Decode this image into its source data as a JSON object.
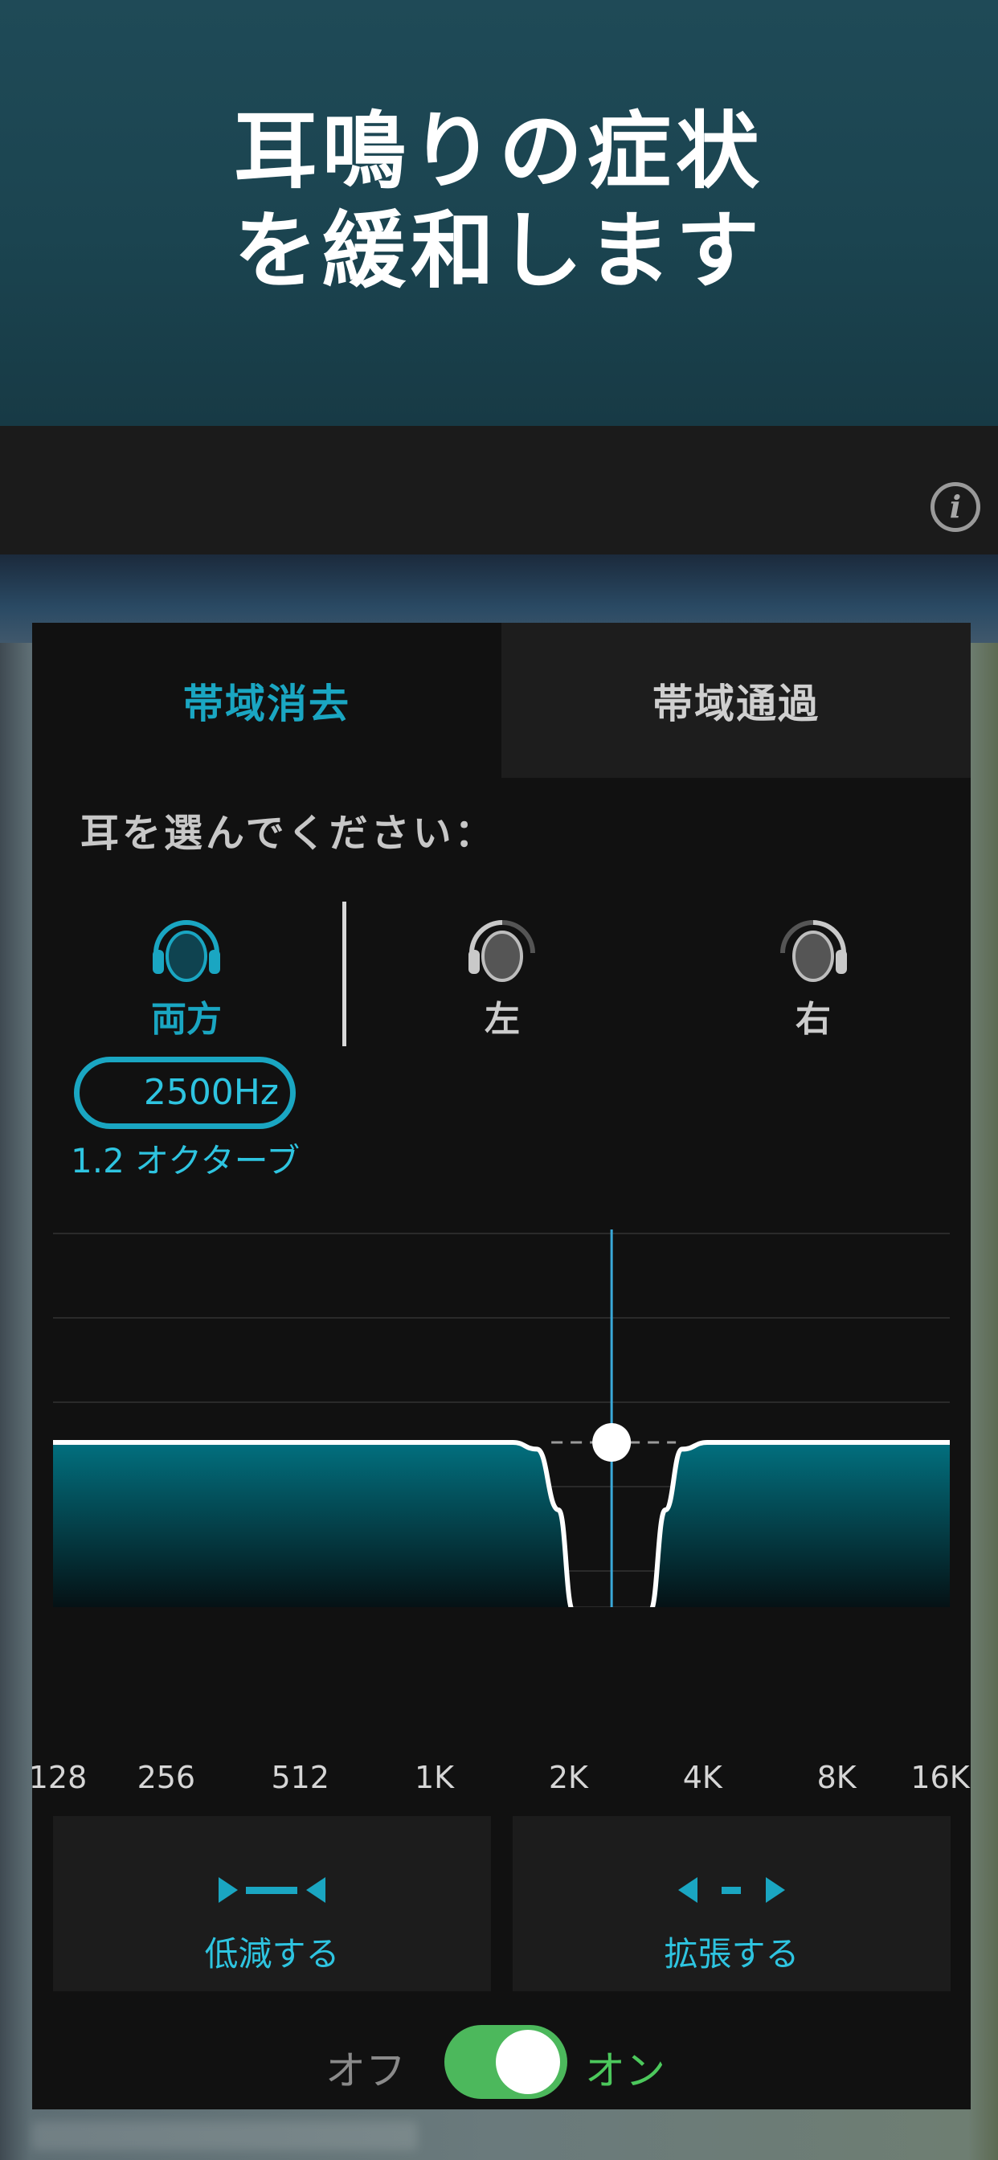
{
  "hero": {
    "line1": "耳鳴りの症状",
    "line2": "を緩和します"
  },
  "app_bar": {
    "info_glyph": "i",
    "info_icon": "info-icon"
  },
  "tabs": [
    {
      "label": "帯域消去",
      "active": true
    },
    {
      "label": "帯域通過",
      "active": false
    }
  ],
  "ear_select": {
    "prompt": "耳を選んでください：",
    "options": [
      {
        "label": "両方",
        "icon": "headphones-icon",
        "selected": true
      },
      {
        "label": "左",
        "icon": "head-left-icon",
        "selected": false
      },
      {
        "label": "右",
        "icon": "head-right-icon",
        "selected": false
      }
    ]
  },
  "filter": {
    "frequency": "2500Hz",
    "width": "1.2 オクターブ"
  },
  "chart_data": {
    "type": "area",
    "title": "",
    "xlabel": "",
    "ylabel": "",
    "x_scale": "log2",
    "x_ticks": [
      "128",
      "256",
      "512",
      "1K",
      "2K",
      "4K",
      "8K",
      "16K"
    ],
    "x_tick_values": [
      128,
      256,
      512,
      1000,
      2000,
      4000,
      8000,
      16000
    ],
    "center_hz": 2500,
    "bandwidth_octaves": 1.2,
    "series": [
      {
        "x": [
          128,
          1500,
          1700,
          1900,
          2050,
          2500,
          3050,
          3300,
          3600,
          4100,
          16000
        ],
        "level": [
          1,
          1,
          0.96,
          0.6,
          0,
          0,
          0,
          0.6,
          0.96,
          1,
          1
        ]
      }
    ],
    "grid": true,
    "colors": {
      "fill_top": "#02707f",
      "fill_bottom": "#050f12",
      "line": "#ffffff",
      "marker_line": "#3aa8d8"
    }
  },
  "actions": {
    "reduce": {
      "label": "低減する",
      "icon": "narrow-arrows-icon"
    },
    "expand": {
      "label": "拡張する",
      "icon": "widen-arrows-icon"
    }
  },
  "toggle": {
    "off_label": "オフ",
    "on_label": "オン",
    "state": "on"
  },
  "colors": {
    "accent": "#1aa6c2",
    "on": "#4cb85c"
  }
}
